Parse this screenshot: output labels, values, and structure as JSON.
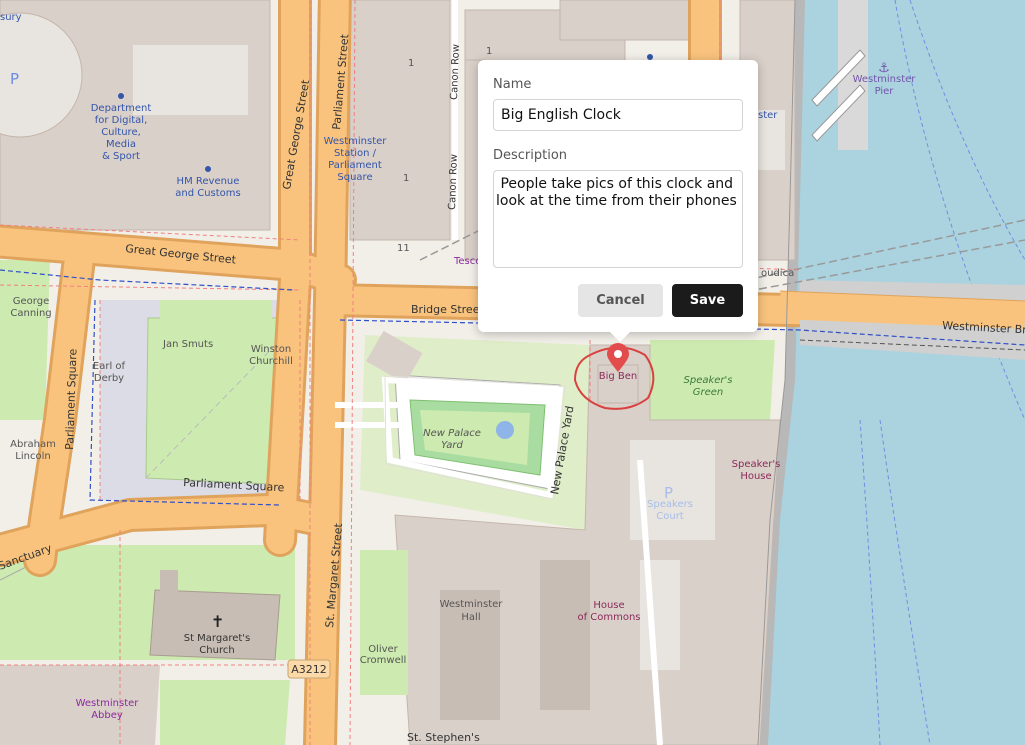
{
  "map": {
    "labels": {
      "treasury": "sury",
      "dept_digital": [
        "Department",
        "for Digital,",
        "Culture,",
        "Media",
        "& Sport"
      ],
      "hm_revenue": [
        "HM Revenue",
        "and Customs"
      ],
      "westminster_station": [
        "Westminster",
        "Station /",
        "Parliament",
        "Square"
      ],
      "westminster_pier": [
        "Westminster",
        "Pier"
      ],
      "great_george_street_upper": "Great George Street",
      "great_george_street": "Great George Street",
      "parliament_street": "Parliament Street",
      "canon_row_1": "Canon Row",
      "canon_row_2": "Canon Row",
      "bridge_street": "Bridge Street",
      "westminster_bridge": "Westminster Bri",
      "george_canning": [
        "George",
        "Canning"
      ],
      "jan_smuts": "Jan Smuts",
      "winston_churchill": [
        "Winston",
        "Churchill"
      ],
      "earl_of_derby": [
        "Earl of",
        "Derby"
      ],
      "abraham_lincoln": [
        "Abraham",
        "Lincoln"
      ],
      "parliament_square_road": "Parliament Square",
      "parliament_square_vertical": "Parliament Square",
      "new_palace_yard_garden": [
        "New Palace",
        "Yard"
      ],
      "new_palace_yard_road": "New Palace Yard",
      "big_ben": "Big Ben",
      "speakers_green": [
        "Speaker's",
        "Green"
      ],
      "speakers_house": [
        "Speaker's",
        "House"
      ],
      "speakers_court": [
        "Speakers",
        "Court"
      ],
      "westminster_hall": [
        "Westminster",
        "Hall"
      ],
      "house_of_commons": [
        "House",
        "of Commons"
      ],
      "st_margarets_street": "St. Margaret Street",
      "st_margarets_church": [
        "St Margaret's",
        "Church"
      ],
      "a3212": "A3212",
      "oliver_cromwell": [
        "Oliver",
        "Cromwell"
      ],
      "westminster_abbey": [
        "Westminster",
        "Abbey"
      ],
      "sanctuary": "Sanctuary",
      "st_stephens": "St. Stephen's",
      "tesco": "Tesco",
      "boudica": "oudica",
      "eleven": "11",
      "one_a": "1",
      "one_b": "1",
      "one_c": "1",
      "parking": "P",
      "ster": "ster",
      "partial_top": "nster"
    }
  },
  "popup": {
    "name_label": "Name",
    "name_value": "Big English Clock",
    "description_label": "Description",
    "description_value": " People take pics of this clock and look at the time from their phones",
    "cancel_label": "Cancel",
    "save_label": "Save"
  },
  "colors": {
    "road": "#f9c37d",
    "road_casing": "#e0a35c",
    "land": "#f2efe9",
    "water": "#aad3df",
    "park": "#cdebb0",
    "building": "#d9d0c9",
    "marker": "#e34c4c",
    "save_button": "#1b1b1b"
  }
}
